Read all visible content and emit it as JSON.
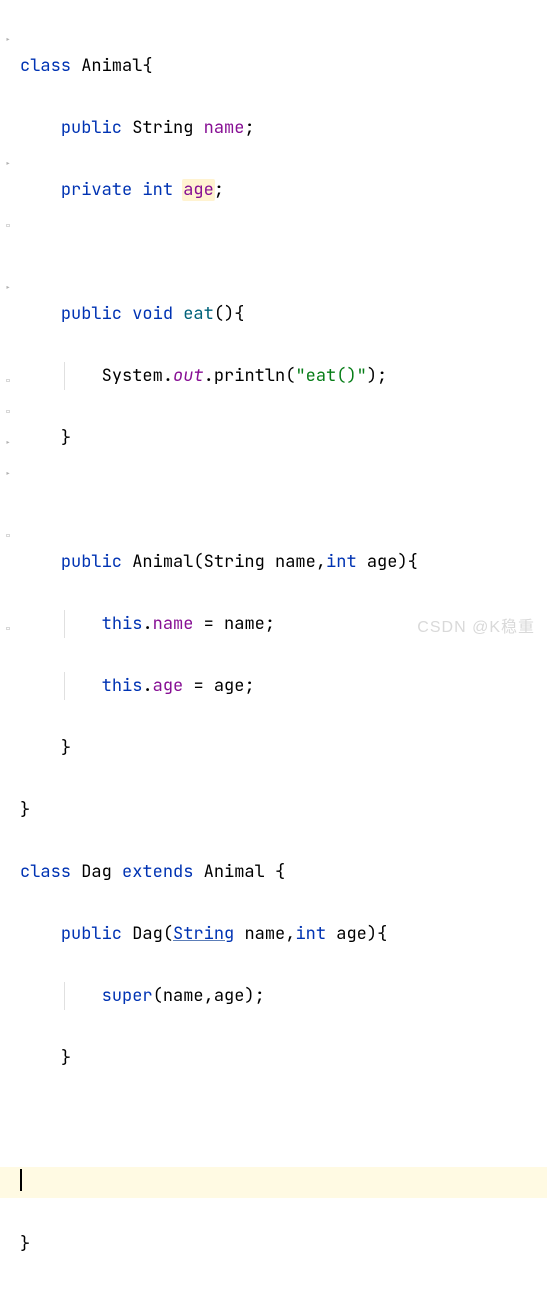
{
  "lines": {
    "l1_kw": "class",
    "l1_name": "Animal",
    "l1_open": "{",
    "l2_mod": "public",
    "l2_type": "String",
    "l2_name": "name",
    "l2_semi": ";",
    "l3_mod": "private",
    "l3_type": "int",
    "l3_name": "age",
    "l3_semi": ";",
    "l4_mod": "public",
    "l4_ret": "void",
    "l4_name": "eat",
    "l4_sig": "(){",
    "l5_a": "System.",
    "l5_out": "out",
    "l5_b": ".println(",
    "l5_str": "\"eat()\"",
    "l5_c": ");",
    "l6_close": "}",
    "l7_mod": "public",
    "l7_name": "Animal",
    "l7_open": "(",
    "l7_p1t": "String",
    "l7_p1n": "name",
    "l7_comma": ",",
    "l7_p2t": "int",
    "l7_p2n": "age",
    "l7_close": "){",
    "l8_a": "this",
    "l8_b": ".",
    "l8_c": "name",
    "l8_d": " = name;",
    "l9_a": "this",
    "l9_b": ".",
    "l9_c": "age",
    "l9_d": " = age;",
    "l10_close": "}",
    "l11_close": "}",
    "l12_kw1": "class",
    "l12_name": "Dag",
    "l12_kw2": "extends",
    "l12_super": "Animal",
    "l12_open": " {",
    "l13_mod": "public",
    "l13_name": "Dag",
    "l13_open": "(",
    "l13_p1t": "String",
    "l13_p1n": "name",
    "l13_comma": ",",
    "l13_p2t": "int",
    "l13_p2n": "age",
    "l13_close": "){",
    "l14_a": "super",
    "l14_b": "(name,age);",
    "l15_close": "}",
    "l16_close": "}"
  },
  "watermark": "CSDN @K稳重"
}
